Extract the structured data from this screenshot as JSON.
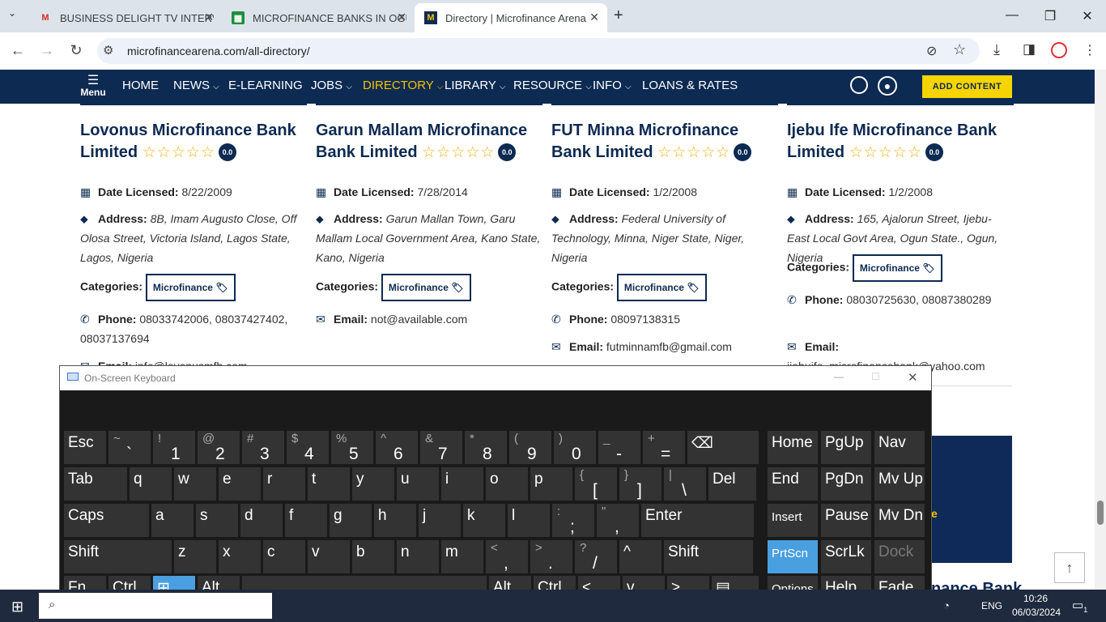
{
  "browser": {
    "tabs": [
      {
        "title": "BUSINESS DELIGHT TV INTERVIE",
        "favicon": "gmail-icon"
      },
      {
        "title": "MICROFINANCE BANKS IN OGUN",
        "favicon": "sheets-icon"
      },
      {
        "title": "Directory | Microfinance Arena",
        "favicon": "site-icon"
      }
    ],
    "url": "microfinancearena.com/all-directory/"
  },
  "nav": {
    "menu_label": "Menu",
    "items": [
      "HOME",
      "NEWS",
      "E-LEARNING",
      "JOBS",
      "DIRECTORY",
      "LIBRARY",
      "RESOURCE",
      "INFO",
      "LOANS & RATES"
    ],
    "active": "DIRECTORY",
    "add_content": "ADD CONTENT"
  },
  "cards": [
    {
      "title": "Lovonus Microfinance Bank Limited",
      "rating": "0.0",
      "date_label": "Date Licensed:",
      "date": "8/22/2009",
      "address_label": "Address:",
      "address": "8B, Imam Augusto Close, Off Olosa Street, Victoria Island, Lagos State, Lagos, Nigeria",
      "categories_label": "Categories:",
      "category": "Microfinance",
      "phone_label": "Phone:",
      "phone": "08033742006, 08037427402, 08037137694",
      "email_label": "Email:",
      "email": "info@lovonusmfb.com"
    },
    {
      "title": "Garun Mallam Microfinance Bank Limited",
      "rating": "0.0",
      "date_label": "Date Licensed:",
      "date": "7/28/2014",
      "address_label": "Address:",
      "address": "Garun Mallan Town, Garu Mallam Local Government Area, Kano State, Kano, Nigeria",
      "categories_label": "Categories:",
      "category": "Microfinance",
      "email_label": "Email:",
      "email": "not@available.com"
    },
    {
      "title": "FUT Minna Microfinance Bank Limited",
      "rating": "0.0",
      "date_label": "Date Licensed:",
      "date": "1/2/2008",
      "address_label": "Address:",
      "address": "Federal University of Technology, Minna, Niger State, Niger, Nigeria",
      "categories_label": "Categories:",
      "category": "Microfinance",
      "phone_label": "Phone:",
      "phone": "08097138315",
      "email_label": "Email:",
      "email": "futminnamfb@gmail.com"
    },
    {
      "title": "Ijebu Ife Microfinance Bank Limited",
      "rating": "0.0",
      "date_label": "Date Licensed:",
      "date": "1/2/2008",
      "address_label": "Address:",
      "address": "165, Ajalorun Street, Ijebu-East Local Govt Area, Ogun State., Ogun, Nigeria",
      "categories_label": "Categories:",
      "category": "Microfinance",
      "phone_label": "Phone:",
      "phone": "08030725630, 08087380289",
      "email_label": "Email:",
      "email": "ijebuife_microfinancebank@yahoo.com"
    }
  ],
  "partial_card_title": "nance Bank",
  "keyboard": {
    "title": "On-Screen Keyboard",
    "rows": [
      [
        [
          "Esc",
          ""
        ],
        [
          "`",
          "~"
        ],
        [
          "1",
          "!"
        ],
        [
          "2",
          "@"
        ],
        [
          "3",
          "#"
        ],
        [
          "4",
          "$"
        ],
        [
          "5",
          "%"
        ],
        [
          "6",
          "^"
        ],
        [
          "7",
          "&"
        ],
        [
          "8",
          "*"
        ],
        [
          "9",
          "("
        ],
        [
          "0",
          ")"
        ],
        [
          "-",
          "_"
        ],
        [
          "=",
          "+"
        ],
        [
          "⌫",
          ""
        ]
      ],
      [
        [
          "Tab",
          ""
        ],
        [
          "q",
          ""
        ],
        [
          "w",
          ""
        ],
        [
          "e",
          ""
        ],
        [
          "r",
          ""
        ],
        [
          "t",
          ""
        ],
        [
          "y",
          ""
        ],
        [
          "u",
          ""
        ],
        [
          "i",
          ""
        ],
        [
          "o",
          ""
        ],
        [
          "p",
          ""
        ],
        [
          "[",
          "{"
        ],
        [
          "]",
          "}"
        ],
        [
          "\\",
          "|"
        ],
        [
          "Del",
          ""
        ]
      ],
      [
        [
          "Caps",
          ""
        ],
        [
          "a",
          ""
        ],
        [
          "s",
          ""
        ],
        [
          "d",
          ""
        ],
        [
          "f",
          ""
        ],
        [
          "g",
          ""
        ],
        [
          "h",
          ""
        ],
        [
          "j",
          ""
        ],
        [
          "k",
          ""
        ],
        [
          "l",
          ""
        ],
        [
          ";",
          ":"
        ],
        [
          ",",
          "\""
        ],
        [
          "Enter",
          ""
        ]
      ],
      [
        [
          "Shift",
          ""
        ],
        [
          "z",
          ""
        ],
        [
          "x",
          ""
        ],
        [
          "c",
          ""
        ],
        [
          "v",
          ""
        ],
        [
          "b",
          ""
        ],
        [
          "n",
          ""
        ],
        [
          "m",
          ""
        ],
        [
          ",",
          "<"
        ],
        [
          ".",
          ">"
        ],
        [
          "/",
          "?"
        ],
        [
          "^",
          ""
        ],
        [
          "Shift",
          ""
        ]
      ],
      [
        [
          "Fn",
          ""
        ],
        [
          "Ctrl",
          ""
        ],
        [
          "⊞",
          ""
        ],
        [
          "Alt",
          ""
        ],
        [
          "",
          ""
        ],
        [
          "Alt",
          ""
        ],
        [
          "Ctrl",
          ""
        ],
        [
          "<",
          ""
        ],
        [
          "v",
          ""
        ],
        [
          ">",
          ""
        ],
        [
          "▤",
          ""
        ]
      ]
    ],
    "side": [
      [
        "Home",
        "PgUp",
        "Nav"
      ],
      [
        "End",
        "PgDn",
        "Mv Up"
      ],
      [
        "Insert",
        "Pause",
        "Mv Dn"
      ],
      [
        "PrtScn",
        "ScrLk",
        "Dock"
      ],
      [
        "Options",
        "Help",
        "Fade"
      ]
    ]
  },
  "taskbar": {
    "lang": "ENG",
    "time": "10:26",
    "date": "06/03/2024",
    "notif": "1"
  }
}
